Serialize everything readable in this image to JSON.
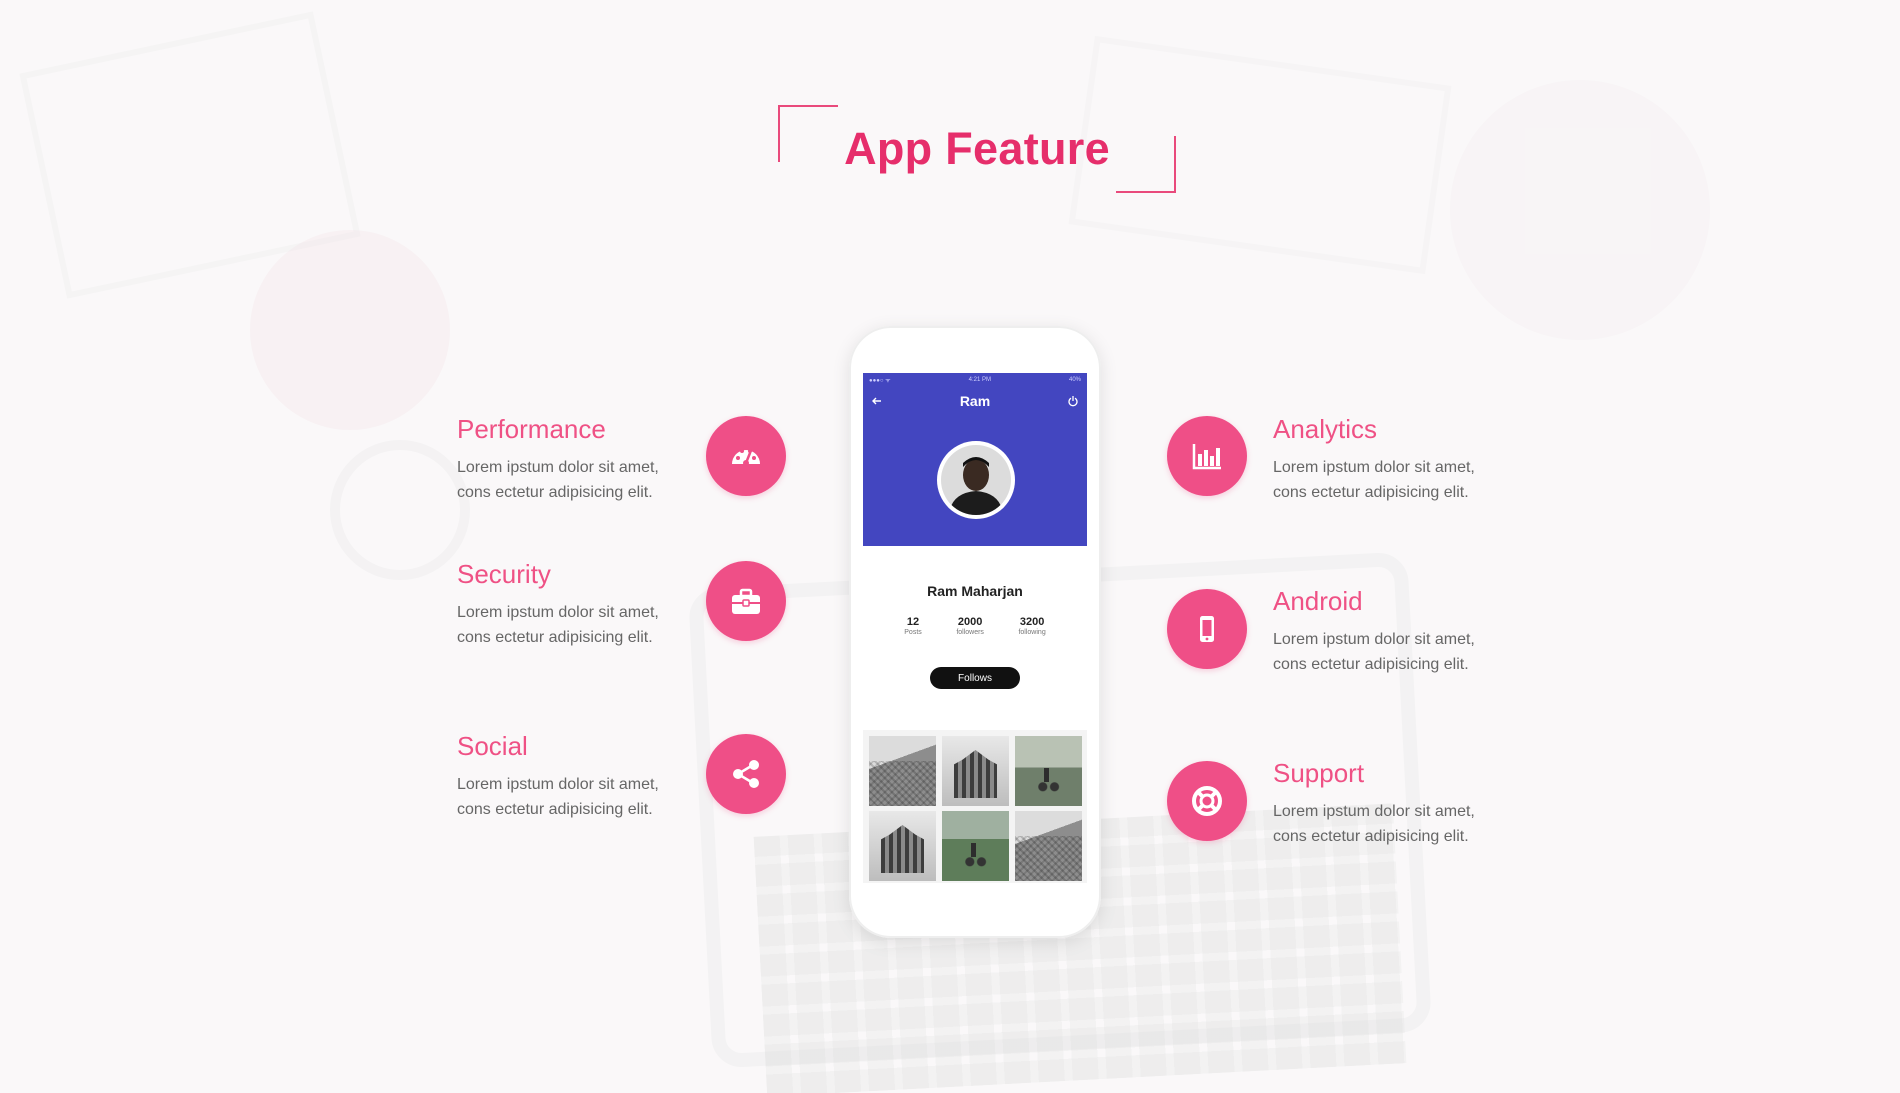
{
  "title": "App Feature",
  "colors": {
    "accent": "#ef4f87",
    "title": "#e62e6b",
    "phone_header": "#4346c0"
  },
  "features_left": [
    {
      "title": "Performance",
      "text": "Lorem ipstum dolor sit amet, cons ectetur adipisicing elit.",
      "icon": "speedometer-icon"
    },
    {
      "title": "Security",
      "text": "Lorem ipstum dolor sit amet, cons ectetur adipisicing elit.",
      "icon": "briefcase-icon"
    },
    {
      "title": "Social",
      "text": "Lorem ipstum dolor sit amet, cons ectetur adipisicing elit.",
      "icon": "share-icon"
    }
  ],
  "features_right": [
    {
      "title": "Analytics",
      "text": "Lorem ipstum dolor sit amet, cons ectetur adipisicing elit.",
      "icon": "bar-chart-icon"
    },
    {
      "title": "Android",
      "text": "Lorem ipstum dolor sit amet, cons ectetur adipisicing elit.",
      "icon": "mobile-icon"
    },
    {
      "title": "Support",
      "text": "Lorem ipstum dolor sit amet, cons ectetur adipisicing elit.",
      "icon": "lifebuoy-icon"
    }
  ],
  "phone": {
    "status_time": "4:21 PM",
    "status_battery": "40%",
    "header_name": "Ram",
    "profile_name": "Ram Maharjan",
    "stats": [
      {
        "num": "12",
        "label": "Posts"
      },
      {
        "num": "2000",
        "label": "followers"
      },
      {
        "num": "3200",
        "label": "following"
      }
    ],
    "follow_label": "Follows",
    "photos": [
      "rocks",
      "building",
      "bikers",
      "building",
      "bikers-color",
      "rocks"
    ]
  }
}
